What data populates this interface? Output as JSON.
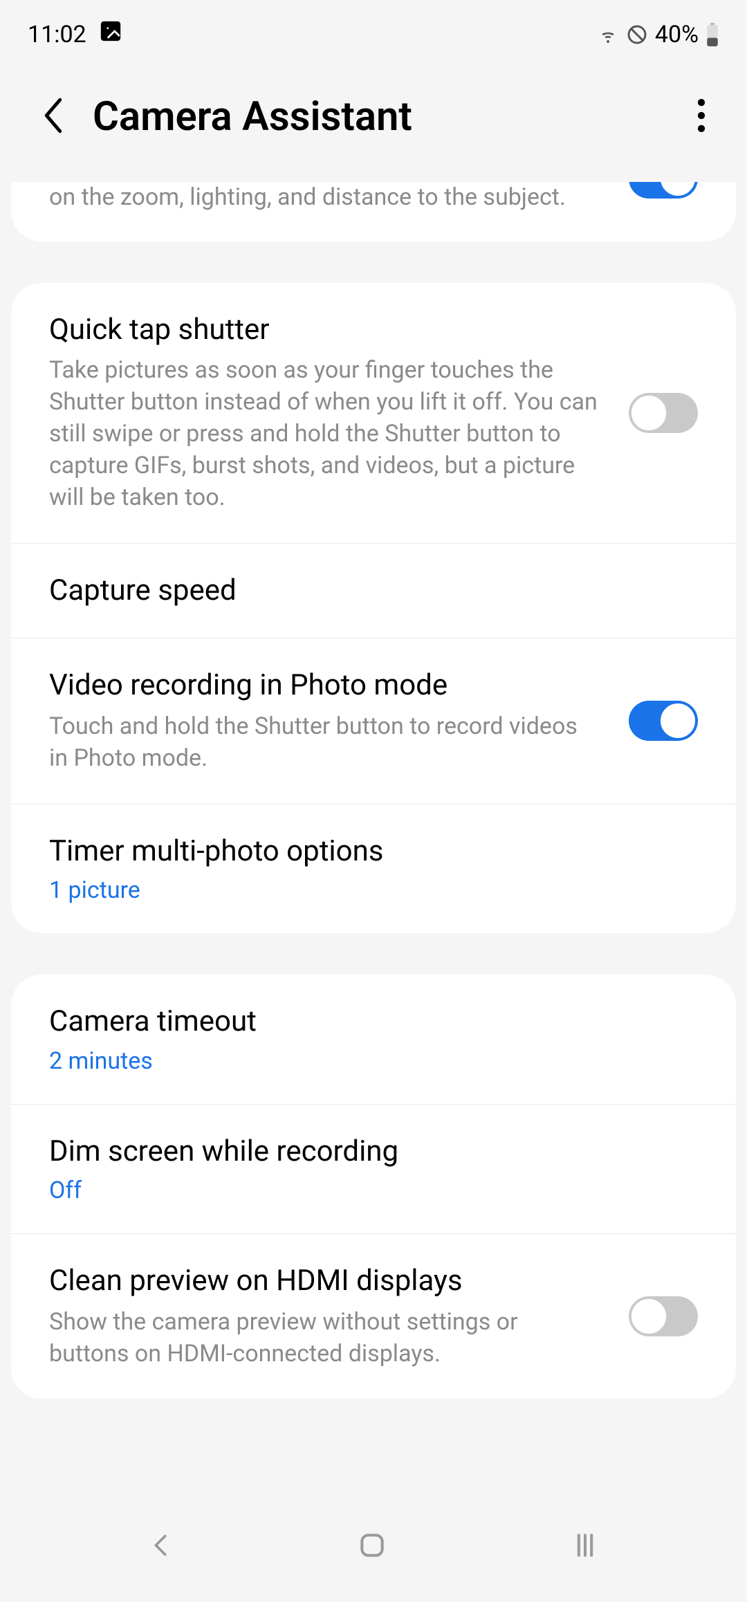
{
  "status": {
    "time": "11:02",
    "battery_text": "40%"
  },
  "header": {
    "title": "Camera Assistant"
  },
  "groups": [
    {
      "rows": [
        {
          "desc_partial": "on the zoom, lighting, and distance to the subject.",
          "toggle": true
        }
      ]
    },
    {
      "rows": [
        {
          "label": "Quick tap shutter",
          "desc": "Take pictures as soon as your finger touches the Shutter button instead of when you lift it off. You can still swipe or press and hold the Shutter button to capture GIFs, burst shots, and videos, but a picture will be taken too.",
          "toggle": false
        },
        {
          "label": "Capture speed"
        },
        {
          "label": "Video recording in Photo mode",
          "desc": "Touch and hold the Shutter button to record videos in Photo mode.",
          "toggle": true
        },
        {
          "label": "Timer multi-photo options",
          "value": "1 picture"
        }
      ]
    },
    {
      "rows": [
        {
          "label": "Camera timeout",
          "value": "2 minutes"
        },
        {
          "label": "Dim screen while recording",
          "value": "Off"
        },
        {
          "label": "Clean preview on HDMI displays",
          "desc": "Show the camera preview without settings or buttons on HDMI-connected displays.",
          "toggle": false
        }
      ]
    }
  ]
}
